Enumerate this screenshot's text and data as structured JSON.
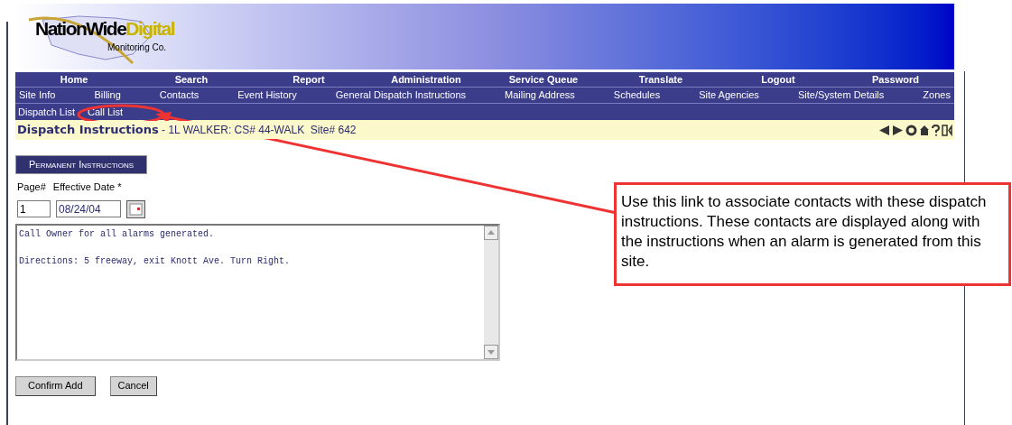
{
  "logo": {
    "brand_dark": "NationWide",
    "brand_light": "Digital",
    "tagline": "Monitoring Co."
  },
  "main_menu": [
    "Home",
    "Search",
    "Report",
    "Administration",
    "Service Queue",
    "Translate",
    "Logout",
    "Password"
  ],
  "sub_menu": [
    "Site Info",
    "Billing",
    "Contacts",
    "Event History",
    "General Dispatch Instructions",
    "Mailing Address",
    "Schedules",
    "Site Agencies",
    "Site/System Details",
    "Zones"
  ],
  "third_menu": [
    "Dispatch List",
    "Call List"
  ],
  "page_header": {
    "title": "Dispatch Instructions",
    "subtitle": " - 1L WALKER: CS# 44-WALK  Site# 642"
  },
  "section_title": "Permanent Instructions",
  "fields": {
    "page_label": "Page#",
    "date_label": "Effective Date *",
    "page_value": "1",
    "date_value": "08/24/04"
  },
  "instructions": "Call Owner for all alarms generated.\n\nDirections: 5 freeway, exit Knott Ave. Turn Right.",
  "buttons": [
    "Confirm Add",
    "Cancel"
  ],
  "callout": "Use this link to associate contacts with these dispatch instructions.  These contacts are displayed along with the instructions when an alarm is generated from this site."
}
